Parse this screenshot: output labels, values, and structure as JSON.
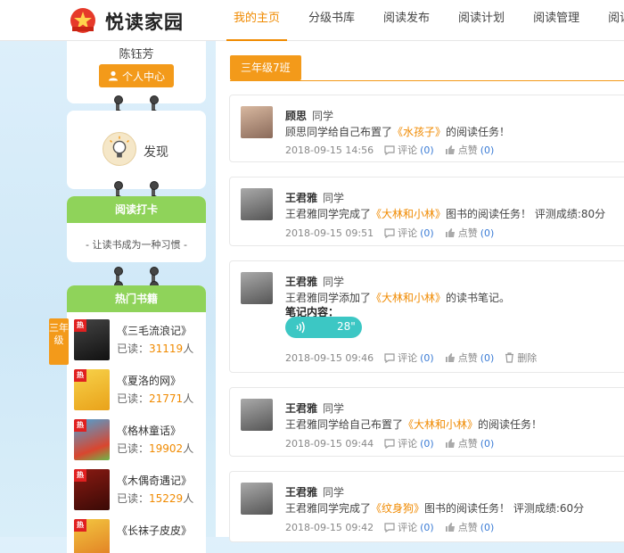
{
  "header": {
    "logo_text": "悦读家园",
    "nav": [
      {
        "label": "我的主页",
        "active": true
      },
      {
        "label": "分级书库",
        "active": false
      },
      {
        "label": "阅读发布",
        "active": false
      },
      {
        "label": "阅读计划",
        "active": false
      },
      {
        "label": "阅读管理",
        "active": false
      },
      {
        "label": "阅读分析",
        "active": false
      }
    ]
  },
  "sidebar": {
    "user_name": "陈钰芳",
    "personal_center_label": "个人中心",
    "discover_label": "发现",
    "checkin_title": "阅读打卡",
    "checkin_slogan": "- 让读书成为一种习惯 -",
    "hot_books_title": "热门书籍",
    "grade_tab_label": "三年级",
    "hot_badge": "热",
    "reads_prefix": "已读：",
    "reads_suffix": "人",
    "books": [
      {
        "title": "《三毛流浪记》",
        "reads": "31119"
      },
      {
        "title": "《夏洛的网》",
        "reads": "21771"
      },
      {
        "title": "《格林童话》",
        "reads": "19902"
      },
      {
        "title": "《木偶奇遇记》",
        "reads": "15229"
      },
      {
        "title": "《长袜子皮皮》",
        "reads": ""
      }
    ]
  },
  "main": {
    "class_tab": "三年级7班",
    "comment_label": "评论",
    "like_label": "点赞",
    "delete_label": "删除",
    "feed": [
      {
        "name": "顾思",
        "role": "同学",
        "text_before": "顾思同学给自己布置了",
        "book": "《水孩子》",
        "text_after": "的阅读任务！",
        "time": "2018-09-15 14:56",
        "comments": "(0)",
        "likes": "(0)"
      },
      {
        "name": "王君雅",
        "role": "同学",
        "text_before": "王君雅同学完成了",
        "book": "《大林和小林》",
        "text_after": "图书的阅读任务！ 评测成绩:80分",
        "time": "2018-09-15 09:51",
        "comments": "(0)",
        "likes": "(0)"
      },
      {
        "name": "王君雅",
        "role": "同学",
        "text_before": "王君雅同学添加了",
        "book": "《大林和小林》",
        "text_after": "的读书笔记。",
        "note_label": "笔记内容：",
        "audio_duration": "28\"",
        "time": "2018-09-15 09:46",
        "comments": "(0)",
        "likes": "(0)"
      },
      {
        "name": "王君雅",
        "role": "同学",
        "text_before": "王君雅同学给自己布置了",
        "book": "《大林和小林》",
        "text_after": "的阅读任务！",
        "time": "2018-09-15 09:44",
        "comments": "(0)",
        "likes": "(0)"
      },
      {
        "name": "王君雅",
        "role": "同学",
        "text_before": "王君雅同学完成了",
        "book": "《纹身狗》",
        "text_after": "图书的阅读任务！ 评测成绩:60分",
        "time": "2018-09-15 09:42",
        "comments": "(0)",
        "likes": "(0)"
      }
    ]
  },
  "colors": {
    "accent": "#f39a1a",
    "link_orange": "#f08a00",
    "green_header": "#8fd35a",
    "count_blue": "#3a7bd5",
    "audio_teal": "#3cc7c4"
  }
}
